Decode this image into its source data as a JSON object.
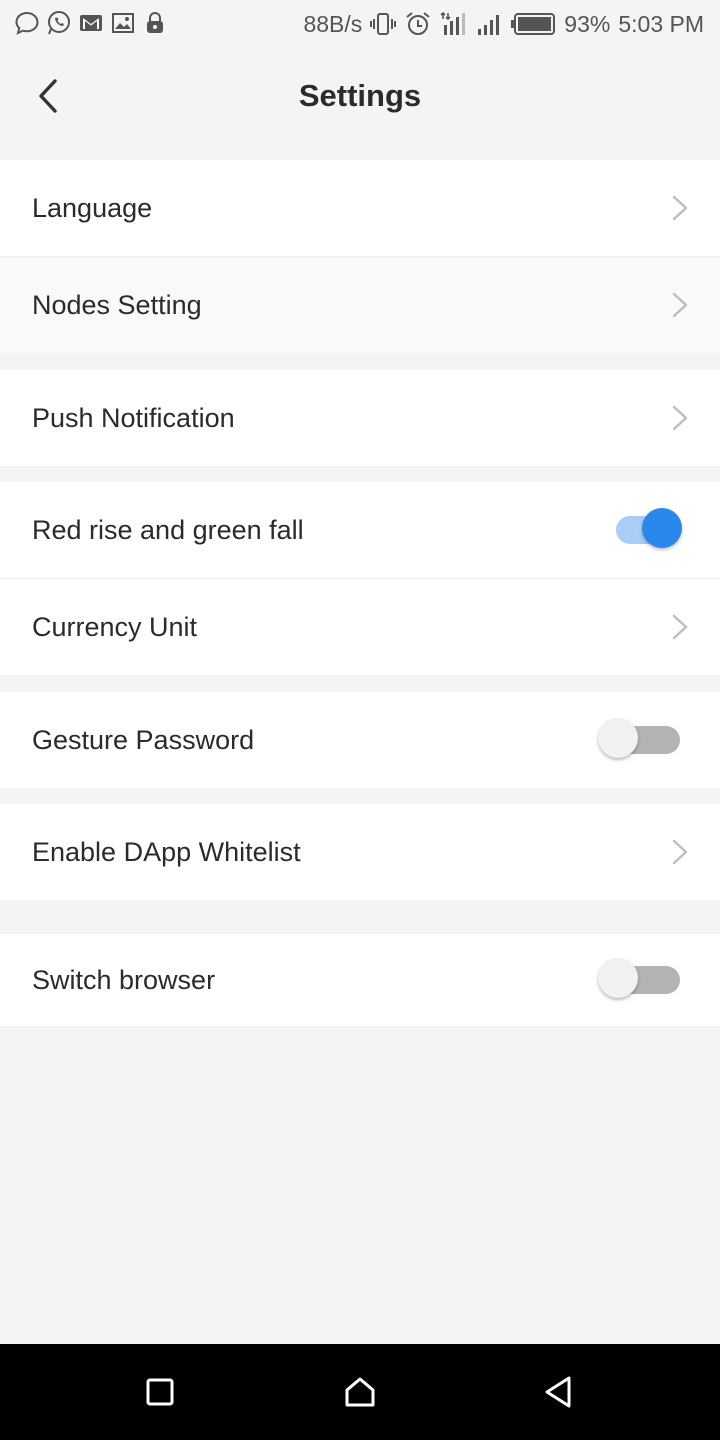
{
  "status_bar": {
    "net_speed": "88B/s",
    "battery": "93%",
    "time": "5:03 PM",
    "icons_left": [
      "chat-bubble-icon",
      "whatsapp-icon",
      "gmail-icon",
      "gallery-icon",
      "lock-icon"
    ],
    "icons_right": [
      "vibrate-icon",
      "alarm-icon",
      "signal-icon",
      "signal-icon-2",
      "battery-icon"
    ]
  },
  "header": {
    "title": "Settings",
    "back_icon": "chevron-left-icon"
  },
  "settings": {
    "language": "Language",
    "nodes_setting": "Nodes Setting",
    "push_notification": "Push Notification",
    "red_rise_green_fall": "Red rise and green fall",
    "red_rise_green_fall_enabled": true,
    "currency_unit": "Currency Unit",
    "gesture_password": "Gesture Password",
    "gesture_password_enabled": false,
    "dapp_whitelist": "Enable DApp Whitelist",
    "switch_browser": "Switch browser",
    "switch_browser_enabled": false
  },
  "colors": {
    "accent": "#2a87ec",
    "accent_track": "#a8cdf6",
    "background": "#f4f4f4"
  },
  "nav_bar": {
    "icons": [
      "recents-icon",
      "home-icon",
      "back-icon"
    ]
  }
}
